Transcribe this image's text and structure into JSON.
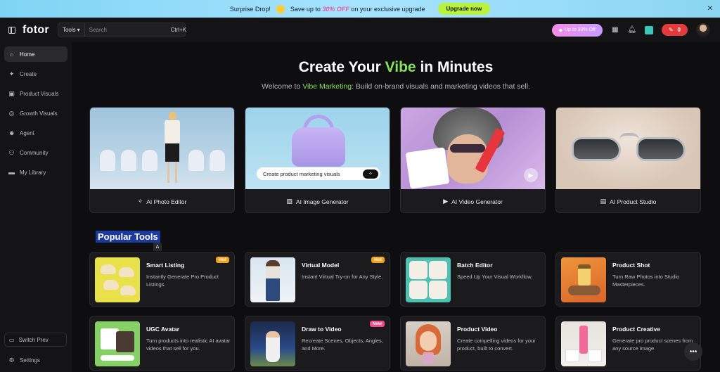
{
  "promo": {
    "lead": "Surprise Drop!",
    "text_before": "Save up to",
    "highlight": "30% OFF",
    "text_after": "on your exclusive upgrade",
    "button": "Upgrade now"
  },
  "header": {
    "logo": "fotor",
    "search": {
      "tools_label": "Tools",
      "placeholder": "Search",
      "shortcut": "Ctrl+K"
    },
    "offer_pill": "Up to 30% Off",
    "credits": "0"
  },
  "sidebar": {
    "items": [
      {
        "label": "Home",
        "icon": "home-icon",
        "active": true
      },
      {
        "label": "Create",
        "icon": "sparkle-icon"
      },
      {
        "label": "Product Visuals",
        "icon": "bag-icon"
      },
      {
        "label": "Growth Visuals",
        "icon": "target-icon"
      },
      {
        "label": "Agent",
        "icon": "agent-icon"
      },
      {
        "label": "Community",
        "icon": "handshake-icon"
      },
      {
        "label": "My Library",
        "icon": "folder-icon"
      }
    ],
    "switch_prev": "Switch Prev",
    "settings": "Settings"
  },
  "hero": {
    "title_before": "Create Your ",
    "title_accent": "Vibe",
    "title_after": " in Minutes",
    "sub_before": "Welcome to ",
    "sub_accent": "Vibe Marketing",
    "sub_after": ": Build on-brand visuals and marketing videos that sell."
  },
  "features": [
    {
      "label": "AI Photo Editor",
      "icon": "magic-wand-icon"
    },
    {
      "label": "AI Image Generator",
      "icon": "image-icon",
      "prompt": "Create product marketing visuals"
    },
    {
      "label": "AI Video Generator",
      "icon": "video-icon"
    },
    {
      "label": "AI Product Studio",
      "icon": "product-icon"
    }
  ],
  "popular": {
    "title": "Popular Tools",
    "tools": [
      {
        "name": "Smart Listing",
        "desc": "Instantly Generate Pro Product Listings.",
        "badge": "Hot"
      },
      {
        "name": "Virtual Model",
        "desc": "Instant Virtual Try-on for Any Style.",
        "badge": "Hot"
      },
      {
        "name": "Batch Editor",
        "desc": "Speed Up Your Visual Workflow.",
        "badge": ""
      },
      {
        "name": "Product Shot",
        "desc": "Turn Raw Photos into Studio Masterpieces.",
        "badge": ""
      },
      {
        "name": "UGC Avatar",
        "desc": "Turn products into realistic AI avatar videos that sell for you.",
        "badge": ""
      },
      {
        "name": "Draw to Video",
        "desc": "Recreate Scenes, Objects, Angles, and More.",
        "badge": "New"
      },
      {
        "name": "Product Video",
        "desc": "Create compelling videos for your product, built to convert.",
        "badge": ""
      },
      {
        "name": "Product Creative",
        "desc": "Generate pro product scenes from any source image.",
        "badge": ""
      }
    ]
  }
}
